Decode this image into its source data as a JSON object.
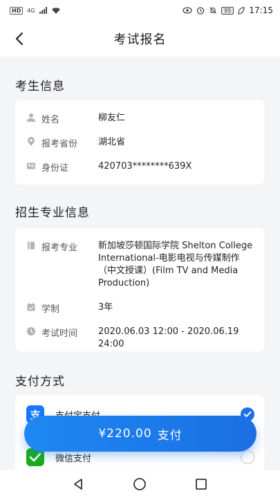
{
  "status_bar": {
    "hd": "HD",
    "network": "4G",
    "battery": "95",
    "time": "17:15"
  },
  "header": {
    "title": "考试报名"
  },
  "candidate": {
    "section_title": "考生信息",
    "rows": [
      {
        "label": "姓名",
        "value": "柳友仁",
        "icon": "person-icon"
      },
      {
        "label": "报考省份",
        "value": "湖北省",
        "icon": "location-pin-icon"
      },
      {
        "label": "身份证",
        "value": "420703********639X",
        "icon": "id-card-icon"
      }
    ]
  },
  "major": {
    "section_title": "招生专业信息",
    "rows": [
      {
        "label": "报考专业",
        "value": "新加坡莎顿国际学院 Shelton College International-电影电视与传媒制作（中文授课）(Film TV and Media Production)",
        "icon": "book-icon"
      },
      {
        "label": "学制",
        "value": "3年",
        "icon": "calendar-check-icon"
      },
      {
        "label": "考试时间",
        "value": "2020.06.03 12:00 - 2020.06.19 24:00",
        "icon": "clock-icon"
      }
    ]
  },
  "payment": {
    "section_title": "支付方式",
    "options": [
      {
        "label": "支付宝支付",
        "selected": true,
        "icon": "alipay-icon",
        "logo_text": "支",
        "color": "#1677ff"
      },
      {
        "label": "微信支付",
        "selected": false,
        "icon": "wechat-pay-icon",
        "color": "#1aad19"
      }
    ]
  },
  "pay_button": {
    "amount": "¥220.00",
    "label": "支付"
  },
  "colors": {
    "accent": "#1f6fe5",
    "background": "#f4f5f7"
  }
}
